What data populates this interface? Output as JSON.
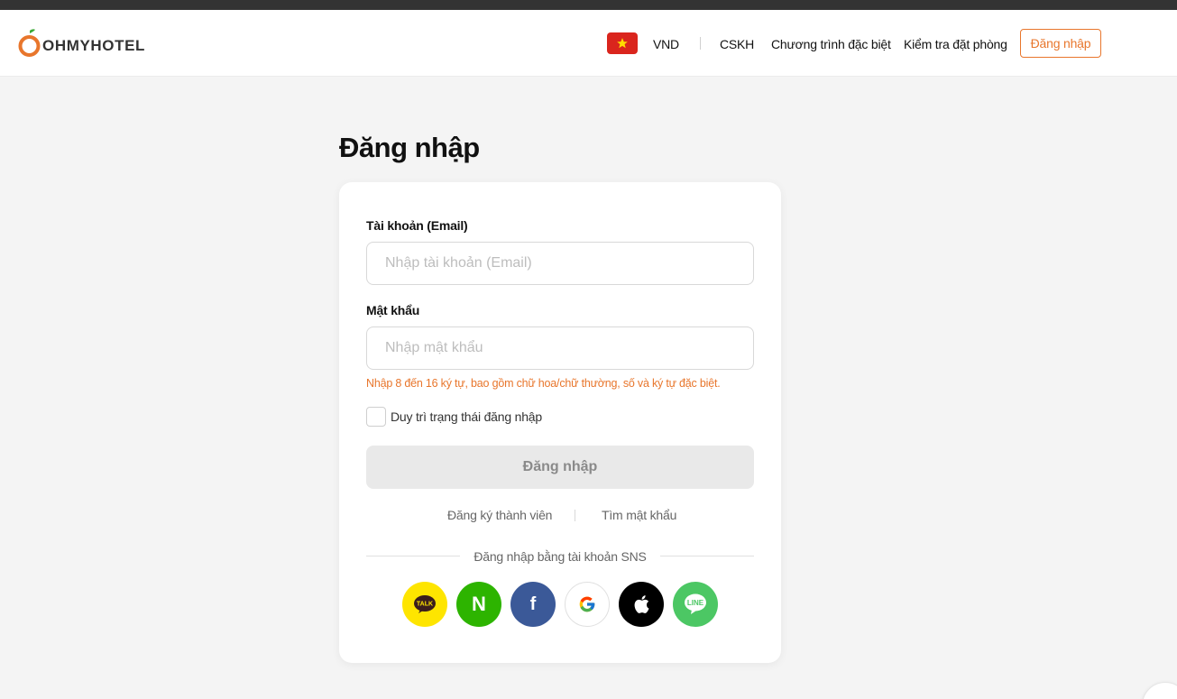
{
  "brand": {
    "logo_text": "OHMYHOTEL"
  },
  "header": {
    "currency": "VND",
    "nav": {
      "support": "CSKH",
      "special": "Chương trình đặc biệt",
      "check_booking": "Kiểm tra đặt phòng"
    },
    "login_button": "Đăng nhập",
    "flag_icon": "vietnam-flag-icon"
  },
  "page": {
    "title": "Đăng nhập"
  },
  "form": {
    "email_label": "Tài khoản (Email)",
    "email_placeholder": "Nhập tài khoản (Email)",
    "email_value": "",
    "password_label": "Mật khẩu",
    "password_placeholder": "Nhập mật khẩu",
    "password_value": "",
    "password_hint": "Nhập 8 đến 16 ký tự, bao gồm chữ hoa/chữ thường, số và ký tự đặc biệt.",
    "remember_label": "Duy trì trạng thái đăng nhập",
    "remember_checked": false,
    "submit_label": "Đăng nhập",
    "signup_link": "Đăng ký thành viên",
    "find_password_link": "Tìm mật khẩu",
    "sns_title": "Đăng nhập bằng tài khoản SNS"
  },
  "sns": {
    "kakao_text": "TALK",
    "naver_text": "N",
    "facebook_text": "f"
  },
  "colors": {
    "accent": "#e8762c",
    "kakao": "#fee500",
    "naver": "#2db400",
    "facebook": "#3b5998",
    "line": "#4cc764"
  }
}
